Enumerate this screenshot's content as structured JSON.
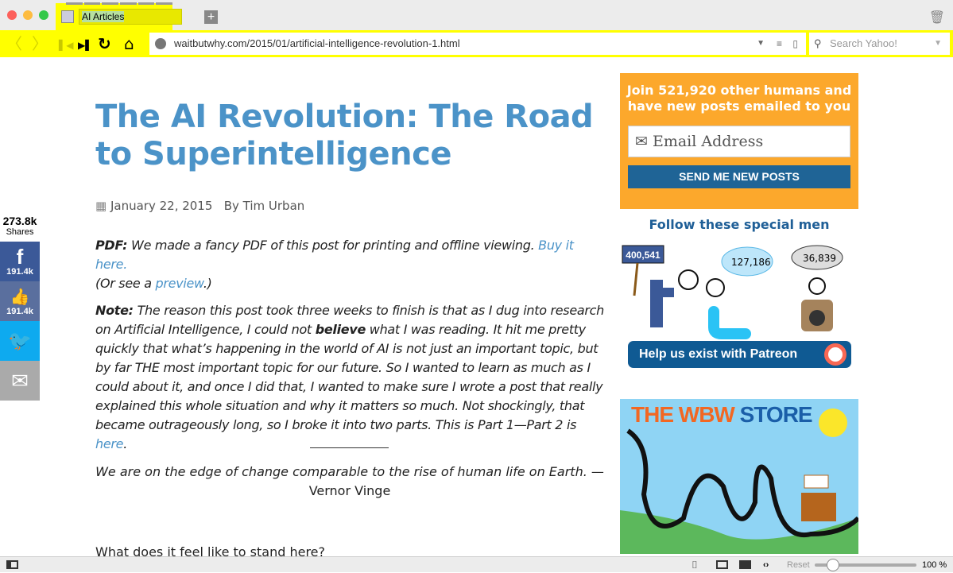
{
  "browser": {
    "tab_title": "AI Articles",
    "url": "waitbutwhy.com/2015/01/artificial-intelligence-revolution-1.html",
    "search_placeholder": "Search Yahoo!",
    "zoom_reset": "Reset",
    "zoom_level": "100 %",
    "zoom_fraction": 0.18,
    "accent": "#ffff00"
  },
  "article": {
    "title": "The AI Revolution: The Road to Superintelligence",
    "date": "January 22, 2015",
    "author": "By Tim Urban",
    "pdf_label": "PDF:",
    "pdf_text": " We made a fancy PDF of this post for printing and offline viewing. ",
    "pdf_link": "Buy it here.",
    "preview_pre": "(Or see a ",
    "preview_link": "preview",
    "preview_post": ".)",
    "note_label": "Note:",
    "note_1": " The reason this post took three weeks to finish is that as I dug into research on Artificial Intelligence, I could not ",
    "note_bold": "believe",
    "note_2": " what I was reading. It hit me pretty quickly that what’s happening in the world of AI is not just an important topic, but by far THE most important topic for our future. So I wanted to learn as much as I could about it, and once I did that, I wanted to make sure I wrote a post that really explained this whole situation and why it matters so much. Not shockingly, that became outrageously long, so I broke it into two parts. This is Part 1—Part 2 is ",
    "note_link": "here",
    "note_end": ".",
    "quote": "We are on the edge of change comparable to the rise of human life on Earth.",
    "quote_author": " — Vernor Vinge",
    "next_heading": "What does it feel like to stand here?"
  },
  "share": {
    "total": "273.8k",
    "label": "Shares",
    "facebook": "191.4k",
    "like": "191.4k"
  },
  "sidebar": {
    "subscribe_heading": "Join 521,920 other humans and have new posts emailed to you",
    "email_placeholder": "Email Address",
    "send_button": "SEND ME NEW POSTS",
    "follow_heading": "Follow these special men",
    "facebook_count": "400,541",
    "twitter_count": "127,186",
    "instagram_count": "36,839",
    "patreon_button": "Help us exist with Patreon",
    "store_title_a": "THE WBW ",
    "store_title_b": "STORE"
  }
}
